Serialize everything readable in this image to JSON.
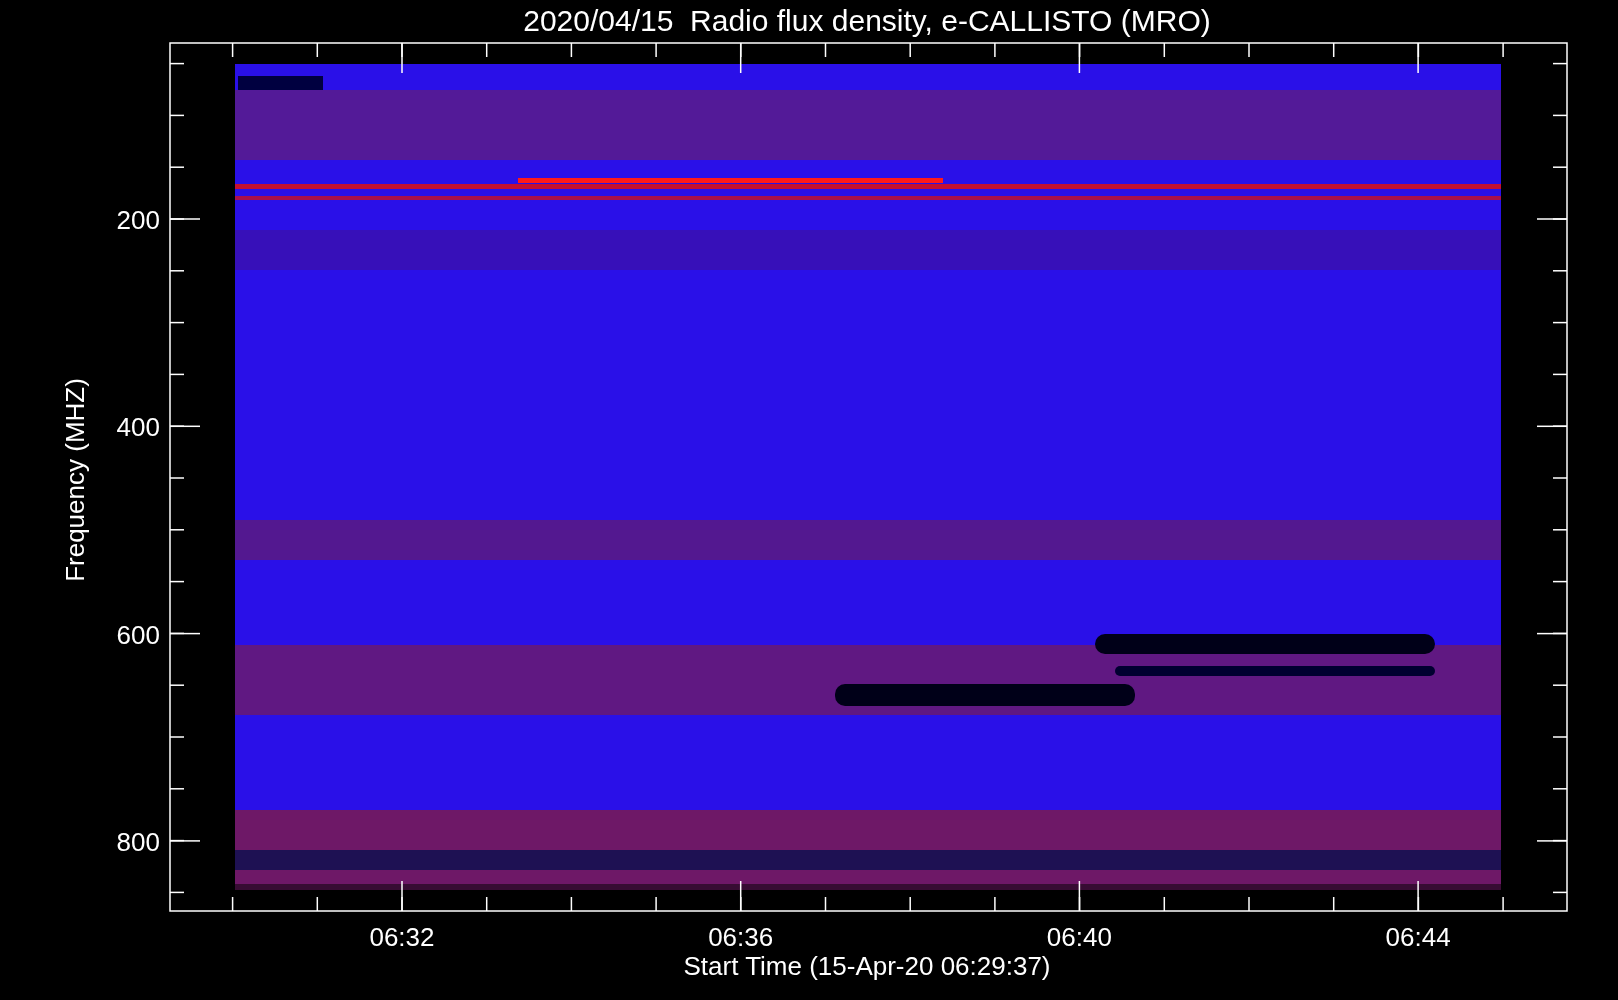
{
  "title": "2020/04/15  Radio flux density, e-CALLISTO (MRO)",
  "y_axis": {
    "label": "Frequency (MHZ)",
    "ticks": [
      "200",
      "400",
      "600",
      "800"
    ]
  },
  "x_axis": {
    "label": "Start Time (15-Apr-20 06:29:37)",
    "ticks": [
      "06:32",
      "06:36",
      "06:40",
      "06:44"
    ]
  }
}
